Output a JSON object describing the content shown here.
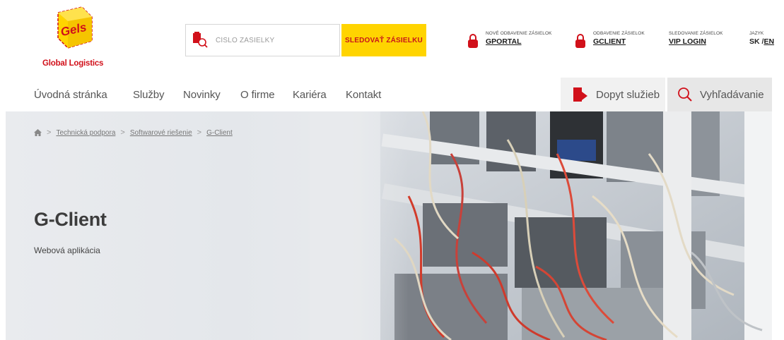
{
  "brand": {
    "logo_word": "Gels",
    "logo_caption": "Global Logistics",
    "red": "#d1101a",
    "yellow": "#ffd400"
  },
  "search": {
    "placeholder": "ČÍSLO ZÁSIELKY",
    "button_label": "SLEDOVAŤ ZÁSIELKU"
  },
  "portals": [
    {
      "small": "NOVÉ ODBAVENIE ZÁSIELOK",
      "link": "GPORTAL",
      "icon": "lock-icon"
    },
    {
      "small": "ODBAVENIE ZÁSIELOK",
      "link": "GCLIENT",
      "icon": "lock-icon"
    }
  ],
  "vip": {
    "small": "SLEDOVANIE ZÁSIELOK",
    "link": "VIP LOGIN"
  },
  "language": {
    "small": "JAZYK",
    "sk": "SK",
    "separator": " /",
    "en": "EN"
  },
  "nav": {
    "items": [
      "Úvodná stránka",
      "Služby",
      "Novinky",
      "O firme",
      "Kariéra",
      "Kontakt"
    ],
    "dopyt": "Dopyt služieb",
    "search": "Vyhľadávanie"
  },
  "breadcrumb": {
    "home_icon": "home-icon",
    "items": [
      "Technická podpora",
      "Softwarové riešenie",
      "G-Client"
    ],
    "separator": ">"
  },
  "hero": {
    "title": "G-Client",
    "subtitle": "Webová aplikácia"
  }
}
